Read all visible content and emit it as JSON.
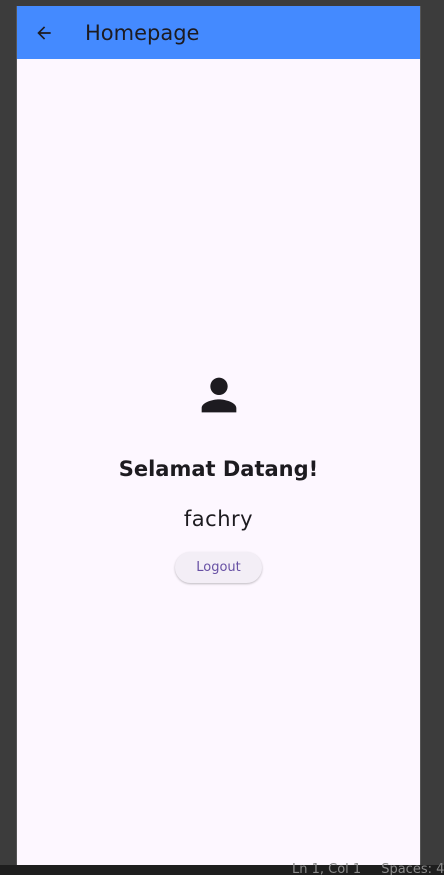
{
  "appbar": {
    "title": "Homepage",
    "back_icon": "arrow-back-icon",
    "color": "#448aff"
  },
  "main": {
    "avatar_icon": "person-icon",
    "welcome_text": "Selamat Datang!",
    "username": "fachry",
    "logout_label": "Logout"
  },
  "editor_status": {
    "position": "Ln 1, Col 1",
    "spaces": "Spaces: 4"
  },
  "colors": {
    "background": "#fdf7ff",
    "button_text": "#6750a4"
  }
}
